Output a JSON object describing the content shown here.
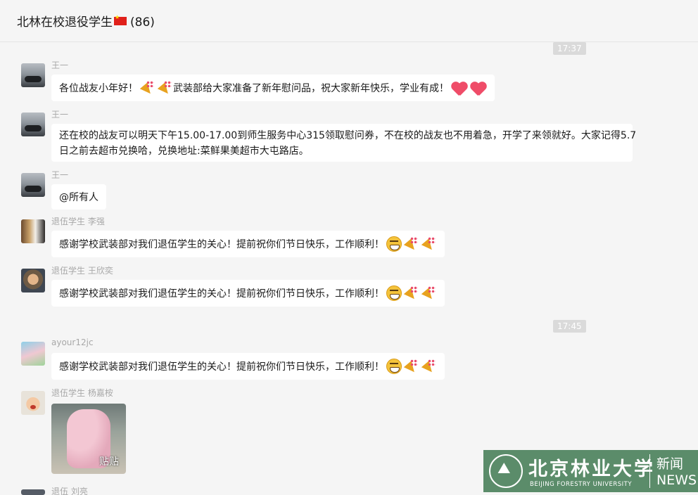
{
  "header": {
    "title": "北林在校退役学生",
    "count": "(86)"
  },
  "timestamps": [
    "17:37",
    "17:45"
  ],
  "messages": [
    {
      "sender": "王一",
      "text": "各位战友小年好！",
      "text2": "武装部给大家准备了新年慰问品，祝大家新年快乐，学业有成！"
    },
    {
      "sender": "王一",
      "line1": "还在校的战友可以明天下午15.00-17.00到师生服务中心315领取慰问券，不在校的战友也不用着急，开学了来领就好。大家记得5.7",
      "line2": "日之前去超市兑换哈，兑换地址:菜鲜果美超市大屯路店。"
    },
    {
      "sender": "王一",
      "text": "@所有人"
    },
    {
      "sender": "退伍学生 李强",
      "text": "感谢学校武装部对我们退伍学生的关心！提前祝你们节日快乐，工作顺利！"
    },
    {
      "sender": "退伍学生 王欣奕",
      "text": "感谢学校武装部对我们退伍学生的关心！提前祝你们节日快乐，工作顺利！"
    },
    {
      "sender": "ayour12jc",
      "text": "感谢学校武装部对我们退伍学生的关心！提前祝你们节日快乐，工作顺利！"
    },
    {
      "sender": "退伍学生 杨嘉桉",
      "sticker_label": "贴贴"
    },
    {
      "sender": "退伍 刘亮"
    }
  ],
  "watermark": {
    "name_cn": "北京林业大学",
    "name_en": "BEIJING FORESTRY UNIVERSITY",
    "news_cn": "新闻",
    "news_en": "NEWS"
  },
  "icons": [
    "flag-icon",
    "party-popper-icon",
    "red-heart-icon",
    "grinning-face-icon"
  ],
  "colors": {
    "background": "#f5f5f5",
    "bubble": "#ffffff",
    "timestamp_bg": "#dadada",
    "watermark_bg": "#5b8c6a"
  }
}
